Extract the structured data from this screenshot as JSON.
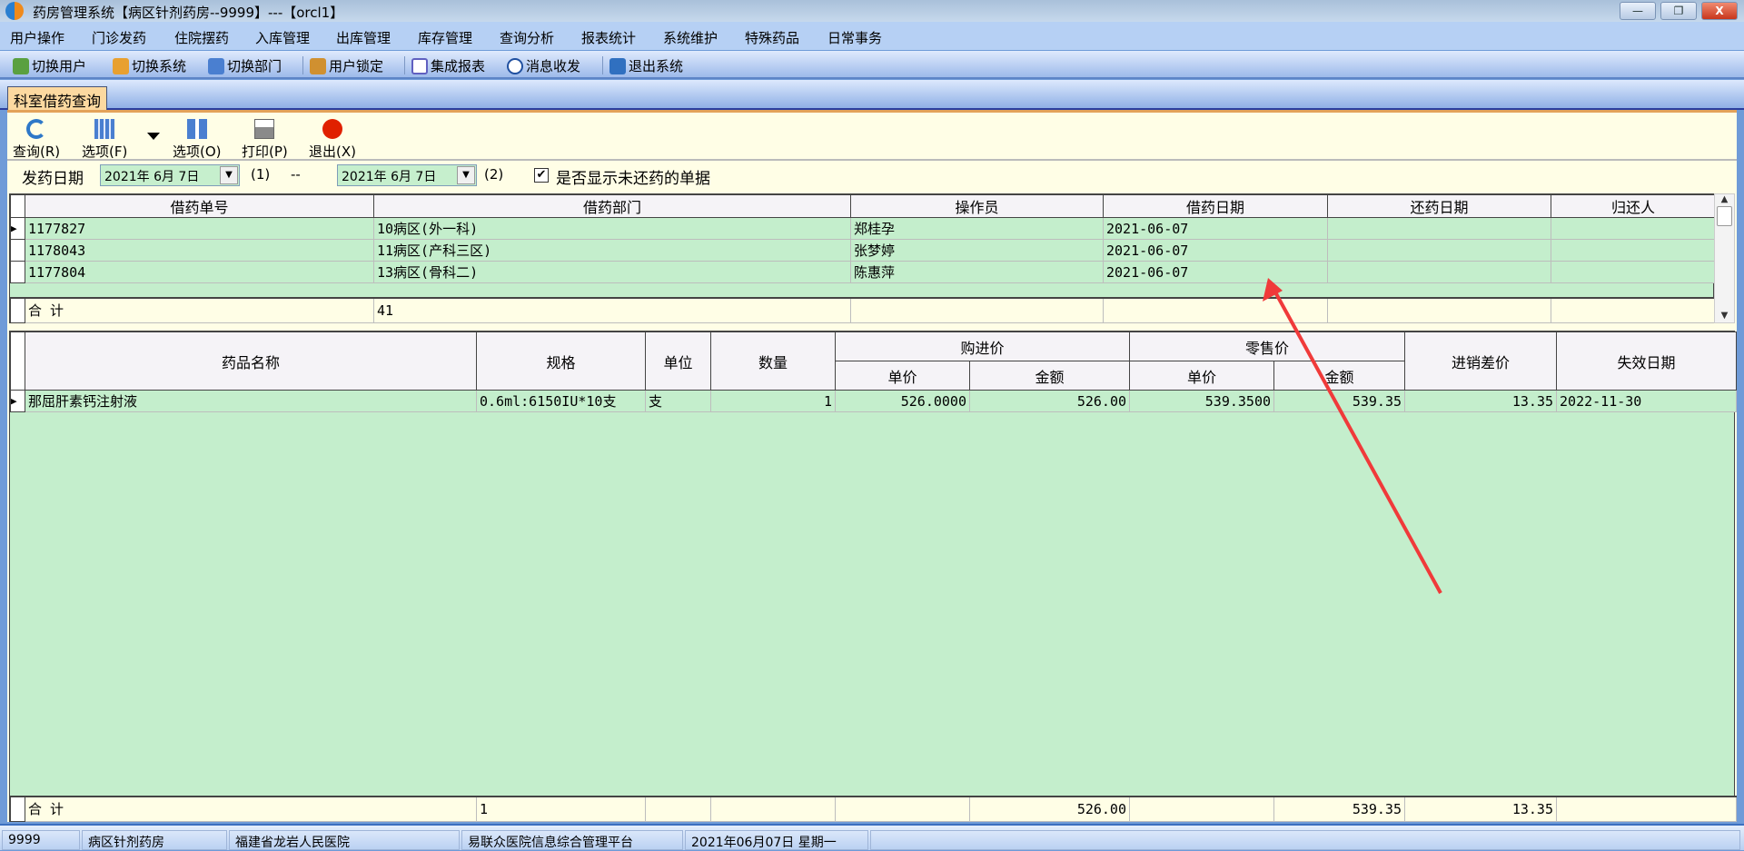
{
  "window": {
    "title": "药房管理系统【病区针剂药房--9999】---【orcl1】",
    "controls": [
      "—",
      "❐",
      "X"
    ]
  },
  "menu": [
    "用户操作",
    "门诊发药",
    "住院摆药",
    "入库管理",
    "出库管理",
    "库存管理",
    "查询分析",
    "报表统计",
    "系统维护",
    "特殊药品",
    "日常事务"
  ],
  "toolbar": [
    {
      "label": "切换用户",
      "icon": "switch-user-icon",
      "color": "#5aa040"
    },
    {
      "label": "切换系统",
      "icon": "switch-system-icon",
      "color": "#e8a030"
    },
    {
      "label": "切换部门",
      "icon": "switch-department-icon",
      "color": "#4a7fd0"
    },
    {
      "label": "用户锁定",
      "icon": "user-lock-icon",
      "color": "#d09030"
    },
    {
      "label": "集成报表",
      "icon": "report-icon",
      "color": "#6060c0"
    },
    {
      "label": "消息收发",
      "icon": "info-icon",
      "color": "#2050a0"
    },
    {
      "label": "退出系统",
      "icon": "exit-icon",
      "color": "#3070c0"
    }
  ],
  "tab": {
    "label": "科室借药查询"
  },
  "actions": [
    {
      "label": "查询(R)",
      "icon": "refresh-icon",
      "color": "#2e78c8"
    },
    {
      "label": "选项(F)",
      "icon": "calendar-grid-icon",
      "color": "#4a7fd0"
    },
    {
      "label": "选项(O)",
      "icon": "transfer-icon",
      "color": "#4a7fd0"
    },
    {
      "label": "打印(P)",
      "icon": "printer-icon",
      "color": "#8a8a8a"
    },
    {
      "label": "退出(X)",
      "icon": "power-icon",
      "color": "#e02000"
    }
  ],
  "filter": {
    "label": "发药日期",
    "date1": "2021年 6月 7日",
    "tag1": "(1)",
    "sep": "--",
    "date2": "2021年 6月 7日",
    "tag2": "(2)",
    "checkbox_label": "是否显示未还药的单据",
    "checked": true
  },
  "grid1": {
    "headers": [
      "借药单号",
      "借药部门",
      "操作员",
      "借药日期",
      "还药日期",
      "归还人"
    ],
    "rows": [
      {
        "no": "1177827",
        "dept": "10病区(外一科)",
        "op": "郑桂孕",
        "date": "2021-06-07",
        "ret": "",
        "who": ""
      },
      {
        "no": "1178043",
        "dept": "11病区(产科三区)",
        "op": "张梦婷",
        "date": "2021-06-07",
        "ret": "",
        "who": ""
      },
      {
        "no": "1177804",
        "dept": "13病区(骨科二)",
        "op": "陈惠萍",
        "date": "2021-06-07",
        "ret": "",
        "who": ""
      }
    ],
    "summary": {
      "label": "合  计",
      "value": "41"
    }
  },
  "grid2": {
    "headers": {
      "name": "药品名称",
      "spec": "规格",
      "unit": "单位",
      "qty": "数量",
      "buy": "购进价",
      "retail": "零售价",
      "unit_price": "单价",
      "amount": "金额",
      "diff": "进销差价",
      "expire": "失效日期"
    },
    "rows": [
      {
        "name": "那屈肝素钙注射液",
        "spec": "0.6ml:6150IU*10支",
        "unit": "支",
        "qty": "1",
        "buy_price": "526.0000",
        "buy_amt": "526.00",
        "retail_price": "539.3500",
        "retail_amt": "539.35",
        "diff": "13.35",
        "expire": "2022-11-30"
      }
    ],
    "summary": {
      "label": "合  计",
      "qty": "1",
      "buy_amt": "526.00",
      "retail_amt": "539.35",
      "diff": "13.35"
    }
  },
  "status": [
    "9999",
    "病区针剂药房",
    "福建省龙岩人民医院",
    "易联众医院信息综合管理平台",
    "2021年06月07日 星期一"
  ],
  "annotation": {
    "color": "#f03a3a"
  }
}
